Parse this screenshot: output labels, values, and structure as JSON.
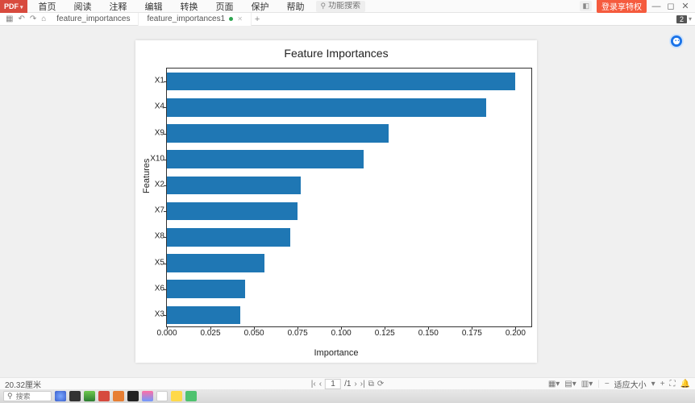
{
  "menubar": {
    "pdf_label": "PDF",
    "items": [
      "首页",
      "阅读",
      "注释",
      "编辑",
      "转换",
      "页面",
      "保护",
      "帮助"
    ],
    "search_placeholder": "功能搜索",
    "login_label": "登录享特权"
  },
  "tabs": {
    "items": [
      {
        "label": "feature_importances"
      },
      {
        "label": "feature_importances1"
      }
    ],
    "page_indicator": "2"
  },
  "statusbar": {
    "left_text": "20.32厘米",
    "page_current": "1",
    "page_total": "/1",
    "zoom_label": "适应大小"
  },
  "taskbar": {
    "search_placeholder": "搜索"
  },
  "chart_data": {
    "type": "bar_horizontal",
    "title": "Feature Importances",
    "xlabel": "Importance",
    "ylabel": "Features",
    "xlim": [
      0.0,
      0.21
    ],
    "xticks": [
      0.0,
      0.025,
      0.05,
      0.075,
      0.1,
      0.125,
      0.15,
      0.175,
      0.2
    ],
    "categories": [
      "X1",
      "X4",
      "X9",
      "X10",
      "X2",
      "X7",
      "X8",
      "X5",
      "X6",
      "X3"
    ],
    "values": [
      0.2,
      0.183,
      0.127,
      0.113,
      0.077,
      0.075,
      0.071,
      0.056,
      0.045,
      0.042
    ],
    "bar_color": "#1f77b4"
  }
}
